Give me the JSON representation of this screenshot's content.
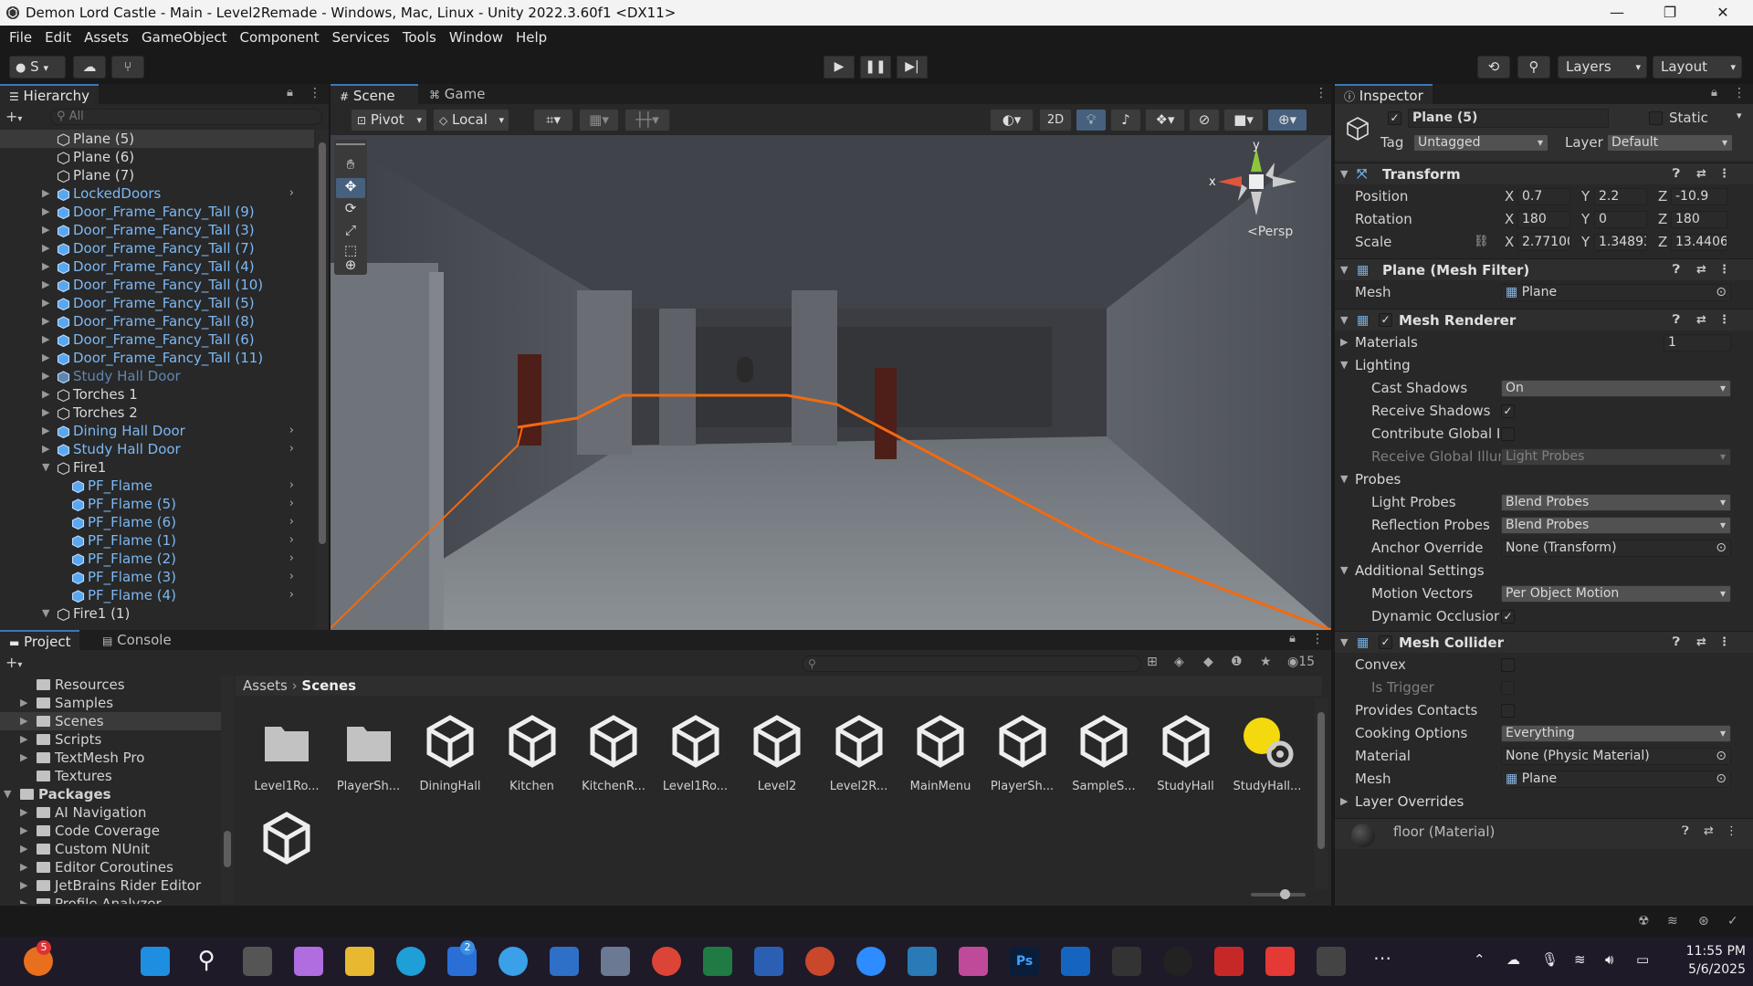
{
  "window": {
    "title": "Demon Lord Castle - Main - Level2Remade - Windows, Mac, Linux - Unity 2022.3.60f1 <DX11>",
    "controls": [
      "—",
      "❐",
      "✕"
    ]
  },
  "menu": [
    "File",
    "Edit",
    "Assets",
    "GameObject",
    "Component",
    "Services",
    "Tools",
    "Window",
    "Help"
  ],
  "toolbar": {
    "account": "S",
    "layers": "Layers",
    "layout": "Layout"
  },
  "hierarchy": {
    "tab": "Hierarchy",
    "search_placeholder": "All",
    "items": [
      {
        "label": "Plane (5)",
        "type": "obj",
        "indent": 0,
        "selected": true,
        "arrow": false,
        "chev": false
      },
      {
        "label": "Plane (6)",
        "type": "obj",
        "indent": 0,
        "arrow": false,
        "chev": false
      },
      {
        "label": "Plane (7)",
        "type": "obj",
        "indent": 0,
        "arrow": false,
        "chev": false
      },
      {
        "label": "LockedDoors",
        "type": "prefab",
        "indent": 0,
        "arrow": "▶",
        "chev": true
      },
      {
        "label": "Door_Frame_Fancy_Tall (9)",
        "type": "prefab",
        "indent": 0,
        "arrow": "▶",
        "chev": false
      },
      {
        "label": "Door_Frame_Fancy_Tall (3)",
        "type": "prefab",
        "indent": 0,
        "arrow": "▶",
        "chev": false
      },
      {
        "label": "Door_Frame_Fancy_Tall (7)",
        "type": "prefab",
        "indent": 0,
        "arrow": "▶",
        "chev": false
      },
      {
        "label": "Door_Frame_Fancy_Tall (4)",
        "type": "prefab",
        "indent": 0,
        "arrow": "▶",
        "chev": false
      },
      {
        "label": "Door_Frame_Fancy_Tall (10)",
        "type": "prefab",
        "indent": 0,
        "arrow": "▶",
        "chev": false
      },
      {
        "label": "Door_Frame_Fancy_Tall (5)",
        "type": "prefab",
        "indent": 0,
        "arrow": "▶",
        "chev": false
      },
      {
        "label": "Door_Frame_Fancy_Tall (8)",
        "type": "prefab",
        "indent": 0,
        "arrow": "▶",
        "chev": false
      },
      {
        "label": "Door_Frame_Fancy_Tall (6)",
        "type": "prefab",
        "indent": 0,
        "arrow": "▶",
        "chev": false
      },
      {
        "label": "Door_Frame_Fancy_Tall (11)",
        "type": "prefab",
        "indent": 0,
        "arrow": "▶",
        "chev": false
      },
      {
        "label": "Study Hall Door",
        "type": "prefab-dim",
        "indent": 0,
        "arrow": "▶",
        "chev": false
      },
      {
        "label": "Torches 1",
        "type": "obj",
        "indent": 0,
        "arrow": "▶",
        "chev": false
      },
      {
        "label": "Torches 2",
        "type": "obj",
        "indent": 0,
        "arrow": "▶",
        "chev": false
      },
      {
        "label": "Dining Hall Door",
        "type": "prefab",
        "indent": 0,
        "arrow": "▶",
        "chev": true
      },
      {
        "label": "Study Hall Door",
        "type": "prefab",
        "indent": 0,
        "arrow": "▶",
        "chev": true
      },
      {
        "label": "Fire1",
        "type": "obj",
        "indent": 0,
        "arrow": "▼",
        "chev": false
      },
      {
        "label": "PF_Flame",
        "type": "prefab",
        "indent": 1,
        "arrow": false,
        "chev": true
      },
      {
        "label": "PF_Flame (5)",
        "type": "prefab",
        "indent": 1,
        "arrow": false,
        "chev": true
      },
      {
        "label": "PF_Flame (6)",
        "type": "prefab",
        "indent": 1,
        "arrow": false,
        "chev": true
      },
      {
        "label": "PF_Flame (1)",
        "type": "prefab",
        "indent": 1,
        "arrow": false,
        "chev": true
      },
      {
        "label": "PF_Flame (2)",
        "type": "prefab",
        "indent": 1,
        "arrow": false,
        "chev": true
      },
      {
        "label": "PF_Flame (3)",
        "type": "prefab",
        "indent": 1,
        "arrow": false,
        "chev": true
      },
      {
        "label": "PF_Flame (4)",
        "type": "prefab",
        "indent": 1,
        "arrow": false,
        "chev": true
      },
      {
        "label": "Fire1 (1)",
        "type": "obj",
        "indent": 0,
        "arrow": "▼",
        "chev": false
      }
    ]
  },
  "scene": {
    "tabs": [
      "Scene",
      "Game"
    ],
    "pivot": "Pivot",
    "local": "Local",
    "mode_2d": "2D",
    "gizmo": {
      "y": "y",
      "x": "x",
      "persp": "<Persp"
    }
  },
  "inspector": {
    "tab": "Inspector",
    "object_name": "Plane (5)",
    "static_label": "Static",
    "tag_label": "Tag",
    "tag_value": "Untagged",
    "layer_label": "Layer",
    "layer_value": "Default",
    "transform": {
      "title": "Transform",
      "position_label": "Position",
      "pos_x": "0.7",
      "pos_y": "2.2",
      "pos_z": "-10.9",
      "rotation_label": "Rotation",
      "rot_x": "180",
      "rot_y": "0",
      "rot_z": "180",
      "scale_label": "Scale",
      "scale_x": "2.77100",
      "scale_y": "1.34893",
      "scale_z": "13.4406"
    },
    "mesh_filter": {
      "title": "Plane (Mesh Filter)",
      "mesh_label": "Mesh",
      "mesh_value": "Plane"
    },
    "mesh_renderer": {
      "title": "Mesh Renderer",
      "materials_label": "Materials",
      "materials_count": "1",
      "lighting_label": "Lighting",
      "cast_shadows_label": "Cast Shadows",
      "cast_shadows_value": "On",
      "receive_shadows_label": "Receive Shadows",
      "contribute_gi_label": "Contribute Global Il",
      "receive_gi_label": "Receive Global Illur",
      "receive_gi_value": "Light Probes",
      "probes_label": "Probes",
      "light_probes_label": "Light Probes",
      "light_probes_value": "Blend Probes",
      "reflection_probes_label": "Reflection Probes",
      "reflection_probes_value": "Blend Probes",
      "anchor_label": "Anchor Override",
      "anchor_value": "None (Transform)",
      "additional_label": "Additional Settings",
      "motion_label": "Motion Vectors",
      "motion_value": "Per Object Motion",
      "dynamic_label": "Dynamic Occlusior"
    },
    "mesh_collider": {
      "title": "Mesh Collider",
      "convex_label": "Convex",
      "trigger_label": "Is Trigger",
      "contacts_label": "Provides Contacts",
      "cooking_label": "Cooking Options",
      "cooking_value": "Everything",
      "material_label": "Material",
      "material_value": "None (Physic Material)",
      "mesh_label": "Mesh",
      "mesh_value": "Plane",
      "layer_overrides_label": "Layer Overrides"
    },
    "material_footer": "floor (Material)"
  },
  "project": {
    "tabs": [
      "Project",
      "Console"
    ],
    "hidden_count": "15",
    "breadcrumb_root": "Assets",
    "breadcrumb_current": "Scenes",
    "tree": [
      {
        "label": "Resources",
        "indent": 1,
        "arrow": ""
      },
      {
        "label": "Samples",
        "indent": 1,
        "arrow": "▶"
      },
      {
        "label": "Scenes",
        "indent": 1,
        "arrow": "▶",
        "selected": true
      },
      {
        "label": "Scripts",
        "indent": 1,
        "arrow": "▶"
      },
      {
        "label": "TextMesh Pro",
        "indent": 1,
        "arrow": "▶"
      },
      {
        "label": "Textures",
        "indent": 1,
        "arrow": ""
      },
      {
        "label": "Packages",
        "indent": 0,
        "arrow": "▼",
        "bold": true
      },
      {
        "label": "AI Navigation",
        "indent": 1,
        "arrow": "▶"
      },
      {
        "label": "Code Coverage",
        "indent": 1,
        "arrow": "▶"
      },
      {
        "label": "Custom NUnit",
        "indent": 1,
        "arrow": "▶"
      },
      {
        "label": "Editor Coroutines",
        "indent": 1,
        "arrow": "▶"
      },
      {
        "label": "JetBrains Rider Editor",
        "indent": 1,
        "arrow": "▶"
      },
      {
        "label": "Profile Analyzer",
        "indent": 1,
        "arrow": "▶"
      }
    ],
    "assets": [
      {
        "label": "Level1Ro...",
        "kind": "folder"
      },
      {
        "label": "PlayerSh...",
        "kind": "folder"
      },
      {
        "label": "DiningHall",
        "kind": "scene"
      },
      {
        "label": "Kitchen",
        "kind": "scene"
      },
      {
        "label": "KitchenR...",
        "kind": "scene"
      },
      {
        "label": "Level1Ro...",
        "kind": "scene"
      },
      {
        "label": "Level2",
        "kind": "scene"
      },
      {
        "label": "Level2R...",
        "kind": "scene"
      },
      {
        "label": "MainMenu",
        "kind": "scene"
      },
      {
        "label": "PlayerSh...",
        "kind": "scene"
      },
      {
        "label": "SampleS...",
        "kind": "scene"
      },
      {
        "label": "StudyHall",
        "kind": "scene"
      },
      {
        "label": "StudyHall...",
        "kind": "lighting"
      },
      {
        "label": "",
        "kind": "scene"
      }
    ]
  },
  "taskbar": {
    "badge_left": "5",
    "badge_store": "2",
    "time": "11:55 PM",
    "date": "5/6/2025"
  },
  "colors": {
    "accent": "#3a79bb",
    "prefab_text": "#7cb8f4",
    "selection_outline": "#f26a10"
  }
}
